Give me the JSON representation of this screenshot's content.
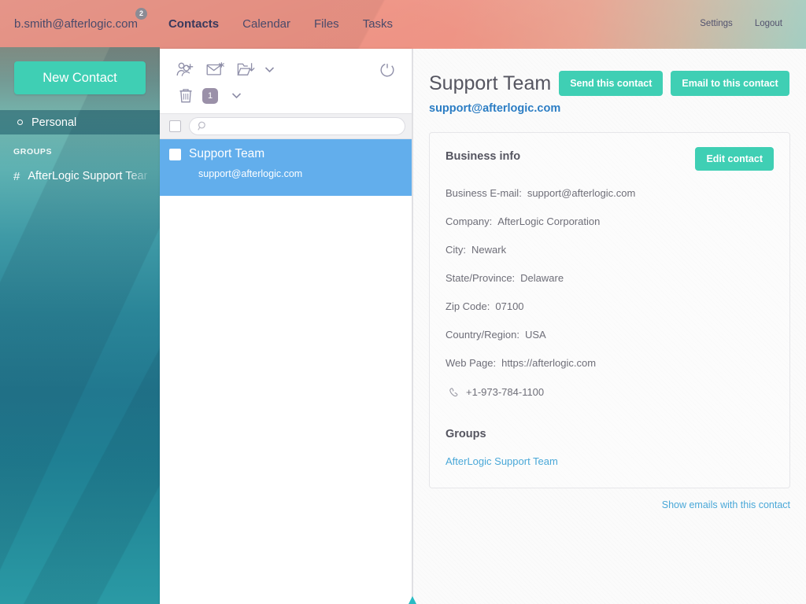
{
  "header": {
    "account_email": "b.smith@afterlogic.com",
    "account_badge": "2",
    "nav": [
      {
        "label": "Contacts",
        "active": true
      },
      {
        "label": "Calendar",
        "active": false
      },
      {
        "label": "Files",
        "active": false
      },
      {
        "label": "Tasks",
        "active": false
      }
    ],
    "settings_label": "Settings",
    "logout_label": "Logout"
  },
  "sidebar": {
    "new_contact_label": "New Contact",
    "items": [
      {
        "label": "Personal",
        "selected": true
      }
    ],
    "groups_title": "GROUPS",
    "groups": [
      {
        "label": "AfterLogic Support Team"
      }
    ]
  },
  "list_panel": {
    "toolbar": {
      "add_contact": "add-contact-icon",
      "new_email": "new-email-icon",
      "import_export": "import-export-icon",
      "import_export_chevron": "chevron-down-icon",
      "refresh": "refresh-icon",
      "delete": "trash-icon",
      "delete_count": "1",
      "more_chevron": "chevron-down-icon"
    },
    "search": {
      "value": "",
      "placeholder": ""
    },
    "contacts": [
      {
        "name": "Support Team",
        "email": "support@afterlogic.com",
        "selected": true,
        "checked": false
      }
    ]
  },
  "detail": {
    "title": "Support Team",
    "email": "support@afterlogic.com",
    "send_contact_label": "Send this contact",
    "email_contact_label": "Email to this contact",
    "business_info_title": "Business info",
    "edit_contact_label": "Edit contact",
    "fields": [
      {
        "label": "Business E-mail:",
        "value": "support@afterlogic.com"
      },
      {
        "label": "Company:",
        "value": "AfterLogic Corporation"
      },
      {
        "label": "City:",
        "value": "Newark"
      },
      {
        "label": "State/Province:",
        "value": "Delaware"
      },
      {
        "label": "Zip Code:",
        "value": "07100"
      },
      {
        "label": "Country/Region:",
        "value": "USA"
      },
      {
        "label": "Web Page:",
        "value": "https://afterlogic.com"
      }
    ],
    "phone": "+1-973-784-1100",
    "groups_title": "Groups",
    "group_links": [
      "AfterLogic Support Team"
    ],
    "show_emails_label": "Show emails with this contact"
  },
  "colors": {
    "accent_teal": "#3fcfb4",
    "selection_blue": "#62aeec",
    "link_blue": "#2b7dc4",
    "soft_link_blue": "#4aa8d8",
    "header_coral": "#ef9182",
    "sidebar_teal": "#21788f",
    "badge_gray": "#8b8b94"
  }
}
